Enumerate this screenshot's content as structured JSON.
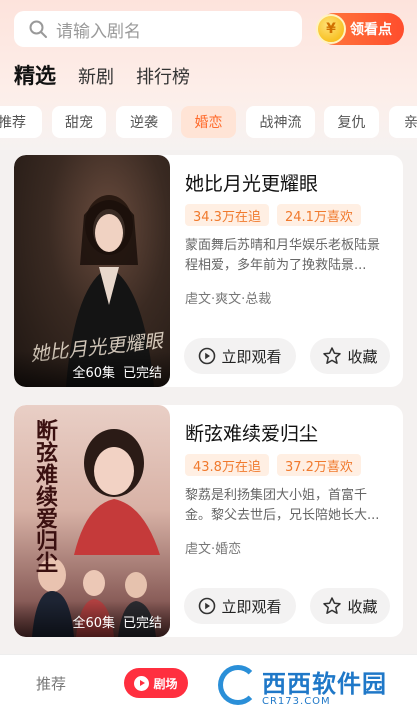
{
  "search": {
    "placeholder": "请输入剧名"
  },
  "coin_button": {
    "label": "领看点",
    "coin_glyph": "¥"
  },
  "main_tabs": [
    {
      "label": "精选",
      "active": true
    },
    {
      "label": "新剧",
      "active": false
    },
    {
      "label": "排行榜",
      "active": false
    }
  ],
  "genres": [
    {
      "label": "推荐",
      "active": false
    },
    {
      "label": "甜宠",
      "active": false
    },
    {
      "label": "逆袭",
      "active": false
    },
    {
      "label": "婚恋",
      "active": true
    },
    {
      "label": "战神流",
      "active": false
    },
    {
      "label": "复仇",
      "active": false
    },
    {
      "label": "亲",
      "active": false
    }
  ],
  "dramas": [
    {
      "title": "她比月光更耀眼",
      "following": "34.3万在追",
      "likes": "24.1万喜欢",
      "description": "蒙面舞后苏晴和月华娱乐老板陆景程相爱，多年前为了挽救陆景...",
      "genre": "虐文·爽文·总裁",
      "episodes": "全60集",
      "status": "已完结",
      "poster_title": "她比月光更耀眼",
      "watch_label": "立即观看",
      "fav_label": "收藏"
    },
    {
      "title": "断弦难续爱归尘",
      "following": "43.8万在追",
      "likes": "37.2万喜欢",
      "description": "黎荔是利扬集团大小姐，首富千金。黎父去世后，兄长陪她长大...",
      "genre": "虐文·婚恋",
      "episodes": "全60集",
      "status": "已完结",
      "poster_title": "断弦难续爱归尘",
      "watch_label": "立即观看",
      "fav_label": "收藏"
    }
  ],
  "bottom_nav": {
    "recommend": "推荐",
    "theater": "剧场"
  },
  "watermark": {
    "name": "西西软件园",
    "url": "CR173.COM"
  },
  "colors": {
    "accent": "#ff6a2b",
    "tag_bg": "#ffefe3",
    "theater_red": "#ff2f3f"
  }
}
